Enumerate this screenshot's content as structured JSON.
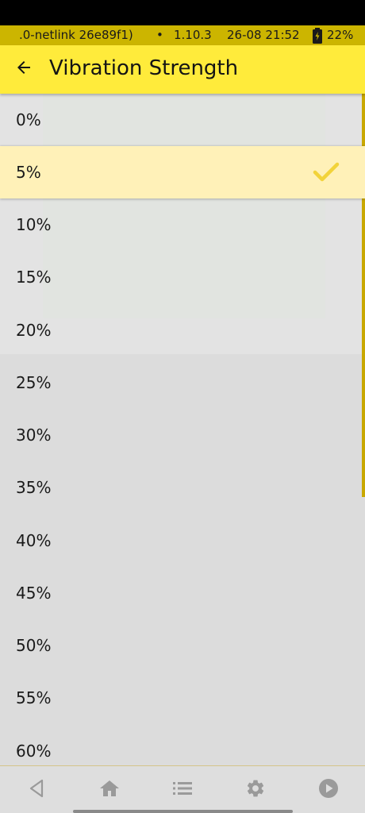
{
  "status_bar": {
    "build": ".0-netlink 26e89f1)",
    "separator": "•",
    "version": "1.10.3",
    "datetime": "26-08 21:52",
    "battery": "22%",
    "battery_icon": "battery-charging-icon"
  },
  "app_bar": {
    "back_icon": "arrow-left-icon",
    "title": "Vibration Strength"
  },
  "options": [
    {
      "label": "0%",
      "selected": false
    },
    {
      "label": "5%",
      "selected": true
    },
    {
      "label": "10%",
      "selected": false
    },
    {
      "label": "15%",
      "selected": false
    },
    {
      "label": "20%",
      "selected": false
    },
    {
      "label": "25%",
      "selected": false
    },
    {
      "label": "30%",
      "selected": false
    },
    {
      "label": "35%",
      "selected": false
    },
    {
      "label": "40%",
      "selected": false
    },
    {
      "label": "45%",
      "selected": false
    },
    {
      "label": "50%",
      "selected": false
    },
    {
      "label": "55%",
      "selected": false
    },
    {
      "label": "60%",
      "selected": false
    }
  ],
  "selected_check_icon": "checkmark-icon",
  "nav_bar": {
    "icons": [
      "back-triangle-icon",
      "home-icon",
      "list-icon",
      "gear-icon",
      "play-circle-icon"
    ]
  },
  "colors": {
    "accent": "#ffeb3b",
    "status_bar": "#ccb500",
    "selected_row": "#fff1b8",
    "checkmark": "#f2d33a",
    "scroll_track": "#c9a800"
  }
}
